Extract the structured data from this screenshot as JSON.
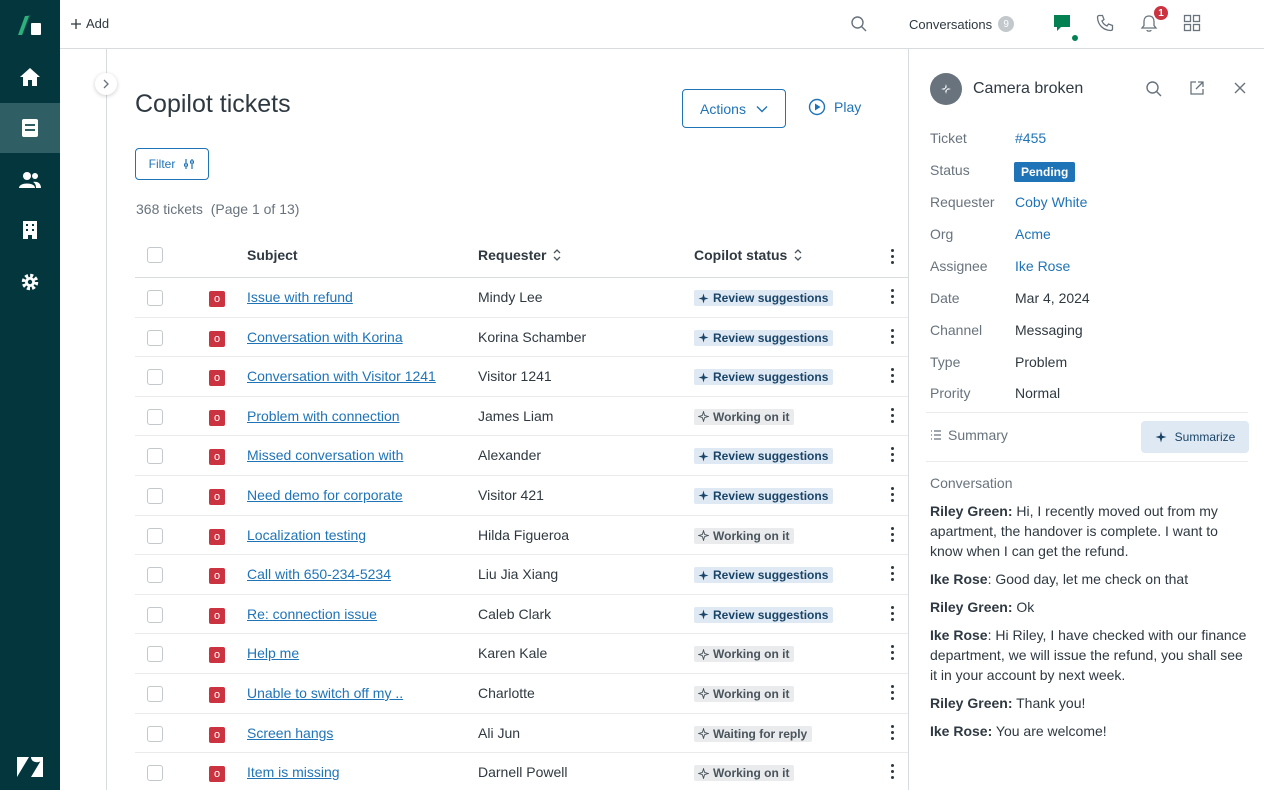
{
  "topbar": {
    "add_label": "Add",
    "conversations_label": "Conversations",
    "conversations_count": "9",
    "notifications_count": "1"
  },
  "main": {
    "title": "Copilot tickets",
    "actions_label": "Actions",
    "play_label": "Play",
    "filter_label": "Filter",
    "count_text": "368 tickets  (Page 1 of 13)",
    "columns": {
      "subject": "Subject",
      "requester": "Requester",
      "copilot_status": "Copilot status"
    },
    "rows": [
      {
        "badge": "o",
        "subject": "Issue with refund",
        "requester": "Mindy Lee",
        "status": "Review suggestions",
        "kind": "review"
      },
      {
        "badge": "o",
        "subject": "Conversation with Korina",
        "requester": "Korina Schamber",
        "status": "Review suggestions",
        "kind": "review"
      },
      {
        "badge": "o",
        "subject": "Conversation with Visitor 1241",
        "requester": "Visitor 1241",
        "status": "Review suggestions",
        "kind": "review"
      },
      {
        "badge": "o",
        "subject": "Problem with connection",
        "requester": "James Liam",
        "status": "Working on it",
        "kind": "working"
      },
      {
        "badge": "o",
        "subject": "Missed conversation with",
        "requester": "Alexander",
        "status": "Review suggestions",
        "kind": "review"
      },
      {
        "badge": "o",
        "subject": "Need demo for corporate",
        "requester": "Visitor 421",
        "status": "Review suggestions",
        "kind": "review"
      },
      {
        "badge": "o",
        "subject": "Localization testing",
        "requester": "Hilda Figueroa",
        "status": "Working on it",
        "kind": "working"
      },
      {
        "badge": "o",
        "subject": "Call with 650-234-5234",
        "requester": "Liu Jia Xiang",
        "status": "Review suggestions",
        "kind": "review"
      },
      {
        "badge": "o",
        "subject": "Re: connection issue",
        "requester": "Caleb Clark",
        "status": "Review suggestions",
        "kind": "review"
      },
      {
        "badge": "o",
        "subject": "Help me",
        "requester": "Karen Kale",
        "status": "Working on it",
        "kind": "working"
      },
      {
        "badge": "o",
        "subject": "Unable to switch off my ..",
        "requester": "Charlotte",
        "status": "Working on it",
        "kind": "working"
      },
      {
        "badge": "o",
        "subject": "Screen hangs",
        "requester": "Ali Jun",
        "status": "Waiting for reply",
        "kind": "working"
      },
      {
        "badge": "o",
        "subject": "Item is missing",
        "requester": "Darnell Powell",
        "status": "Working on it",
        "kind": "working"
      }
    ]
  },
  "panel": {
    "title": "Camera broken",
    "fields": {
      "ticket_label": "Ticket",
      "ticket_value": "#455",
      "status_label": "Status",
      "status_value": "Pending",
      "requester_label": "Requester",
      "requester_value": "Coby White",
      "org_label": "Org",
      "org_value": "Acme",
      "assignee_label": "Assignee",
      "assignee_value": "Ike Rose",
      "date_label": "Date",
      "date_value": "Mar 4, 2024",
      "channel_label": "Channel",
      "channel_value": "Messaging",
      "type_label": "Type",
      "type_value": "Problem",
      "priority_label": "Prority",
      "priority_value": "Normal"
    },
    "summary_label": "Summary",
    "summarize_label": "Summarize",
    "conversation_label": "Conversation",
    "messages": [
      {
        "author": "Riley Green:",
        "text": " Hi, I recently moved out from my apartment, the handover is complete. I want to know when I can get the refund."
      },
      {
        "author": "Ike Rose",
        "text": ": Good day, let me check on that"
      },
      {
        "author": "Riley Green:",
        "text": " Ok"
      },
      {
        "author": "Ike Rose",
        "text": ": Hi Riley, I have checked with our finance department, we will issue the refund, you shall see it in your account by next week."
      },
      {
        "author": "Riley Green:",
        "text": " Thank you!"
      },
      {
        "author": "Ike Rose:",
        "text": " You are welcome!"
      }
    ]
  },
  "colors": {
    "nav_bg": "#03363d",
    "link": "#1f73b7",
    "badge_red": "#cc3340",
    "review_bg": "#dfe9f3",
    "working_bg": "#e9ebed"
  }
}
